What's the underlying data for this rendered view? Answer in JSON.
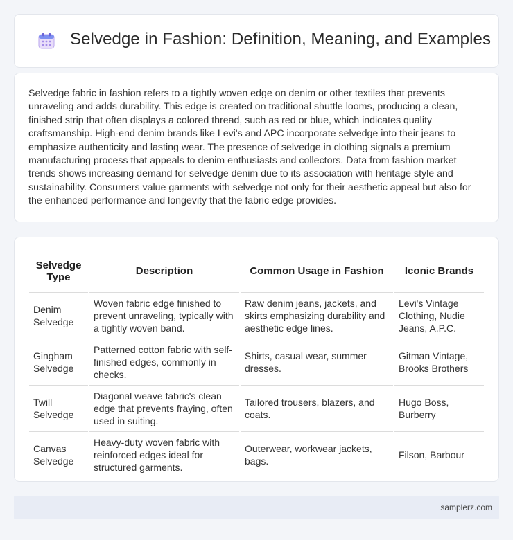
{
  "header": {
    "title": "Selvedge in Fashion: Definition, Meaning, and Examples",
    "icon": "calendar-icon"
  },
  "intro": {
    "text": "Selvedge fabric in fashion refers to a tightly woven edge on denim or other textiles that prevents unraveling and adds durability. This edge is created on traditional shuttle looms, producing a clean, finished strip that often displays a colored thread, such as red or blue, which indicates quality craftsmanship. High-end denim brands like Levi's and APC incorporate selvedge into their jeans to emphasize authenticity and lasting wear. The presence of selvedge in clothing signals a premium manufacturing process that appeals to denim enthusiasts and collectors. Data from fashion market trends shows increasing demand for selvedge denim due to its association with heritage style and sustainability. Consumers value garments with selvedge not only for their aesthetic appeal but also for the enhanced performance and longevity that the fabric edge provides."
  },
  "table": {
    "headers": [
      "Selvedge Type",
      "Description",
      "Common Usage in Fashion",
      "Iconic Brands"
    ],
    "rows": [
      [
        "Denim Selvedge",
        "Woven fabric edge finished to prevent unraveling, typically with a tightly woven band.",
        "Raw denim jeans, jackets, and skirts emphasizing durability and aesthetic edge lines.",
        "Levi's Vintage Clothing, Nudie Jeans, A.P.C."
      ],
      [
        "Gingham Selvedge",
        "Patterned cotton fabric with self-finished edges, commonly in checks.",
        "Shirts, casual wear, summer dresses.",
        "Gitman Vintage, Brooks Brothers"
      ],
      [
        "Twill Selvedge",
        "Diagonal weave fabric's clean edge that prevents fraying, often used in suiting.",
        "Tailored trousers, blazers, and coats.",
        "Hugo Boss, Burberry"
      ],
      [
        "Canvas Selvedge",
        "Heavy-duty woven fabric with reinforced edges ideal for structured garments.",
        "Outerwear, workwear jackets, bags.",
        "Filson, Barbour"
      ]
    ]
  },
  "footer": {
    "site": "samplerz.com"
  }
}
